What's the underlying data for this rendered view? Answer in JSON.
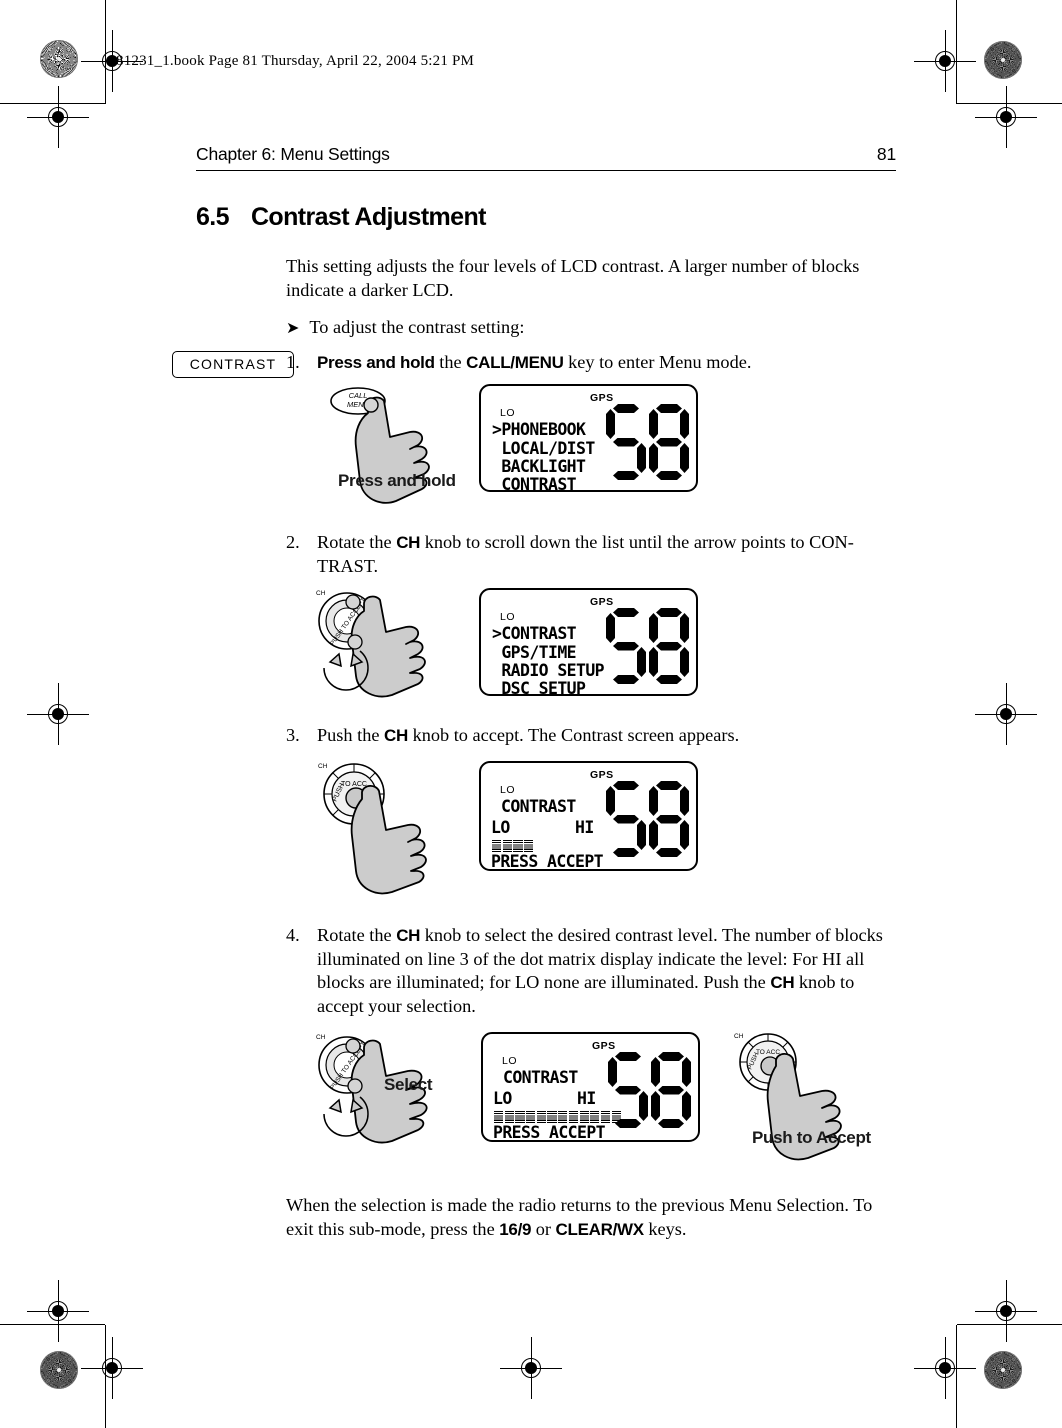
{
  "print_marks": {
    "job_line": "81231_1.book  Page 81  Thursday, April 22, 2004  5:21 PM"
  },
  "header": {
    "chapter": "Chapter 6: Menu Settings",
    "page_number": "81"
  },
  "section": {
    "number": "6.5",
    "title": "Contrast Adjustment"
  },
  "intro": {
    "paragraph": "This setting adjusts the four levels of LCD contrast. A larger number of blocks indicate a darker LCD.",
    "bullet_arrow": "➤",
    "bullet_text": "To adjust the contrast setting:"
  },
  "key_label": {
    "contrast": "CONTRAST"
  },
  "steps": [
    {
      "number": "1.",
      "parts": [
        {
          "text": "Press and hold",
          "style": "bold"
        },
        {
          "text": " the ",
          "style": "normal"
        },
        {
          "text": "CALL/MENU",
          "style": "bold"
        },
        {
          "text": " key to enter Menu mode.",
          "style": "normal"
        }
      ]
    },
    {
      "number": "2.",
      "parts": [
        {
          "text": "Rotate the ",
          "style": "normal"
        },
        {
          "text": "CH",
          "style": "bold"
        },
        {
          "text": " knob to scroll down the list until the arrow points to CON-TRAST.",
          "style": "normal"
        }
      ]
    },
    {
      "number": "3.",
      "parts": [
        {
          "text": "Push the ",
          "style": "normal"
        },
        {
          "text": "CH",
          "style": "bold"
        },
        {
          "text": " knob to accept. The Contrast screen appears.",
          "style": "normal"
        }
      ]
    },
    {
      "number": "4.",
      "parts": [
        {
          "text": "Rotate the ",
          "style": "normal"
        },
        {
          "text": "CH",
          "style": "bold"
        },
        {
          "text": " knob to select the desired contrast level. The number of blocks illuminated on line 3 of the dot matrix display indicate the level: For HI all blocks are illuminated; for LO none are illuminated. Push the ",
          "style": "normal"
        },
        {
          "text": "CH",
          "style": "bold"
        },
        {
          "text": " knob to accept your selection.",
          "style": "normal"
        }
      ]
    }
  ],
  "figures": {
    "fig1": {
      "caption": "Press and hold",
      "knob_label_top": "CALL",
      "knob_label_bottom": "MENU",
      "lcd": {
        "gps": "GPS",
        "lo": "LO",
        "lines": [
          ">PHONEBOOK",
          " LOCAL/DIST",
          " BACKLIGHT",
          " CONTRAST"
        ],
        "channel_digits": "68"
      }
    },
    "fig2": {
      "knob_label": "CH",
      "knob_ring_text": "PUSH TO ACCEPT",
      "lcd": {
        "gps": "GPS",
        "lo": "LO",
        "lines": [
          ">CONTRAST",
          " GPS/TIME",
          " RADIO SETUP",
          " DSC SETUP"
        ],
        "channel_digits": "68"
      }
    },
    "fig3": {
      "knob_label": "CH",
      "knob_ring_text": "PUSH TO ACCEPT",
      "lcd": {
        "gps": "GPS",
        "lo": "LO",
        "title": "CONTRAST",
        "scale_low": "LO",
        "scale_high": "HI",
        "blocks_filled": 4,
        "blocks_total": 18,
        "prompt": "PRESS ACCEPT",
        "channel_digits": "68"
      }
    },
    "fig4": {
      "caption_left": "Select",
      "caption_right": "Push to Accept",
      "knob_label": "CH",
      "knob_ring_text": "PUSH TO ACCEPT",
      "lcd": {
        "gps": "GPS",
        "lo": "LO",
        "title": "CONTRAST",
        "scale_low": "LO",
        "scale_high": "HI",
        "blocks_filled": 18,
        "blocks_total": 18,
        "prompt": "PRESS ACCEPT",
        "channel_digits": "68"
      }
    }
  },
  "closing": {
    "parts": [
      {
        "text": "When the selection is made the radio returns to the previous Menu Selection. To exit this sub-mode, press the ",
        "style": "normal"
      },
      {
        "text": "16/9",
        "style": "bold"
      },
      {
        "text": " or ",
        "style": "normal"
      },
      {
        "text": "CLEAR/WX",
        "style": "bold"
      },
      {
        "text": " keys.",
        "style": "normal"
      }
    ]
  }
}
